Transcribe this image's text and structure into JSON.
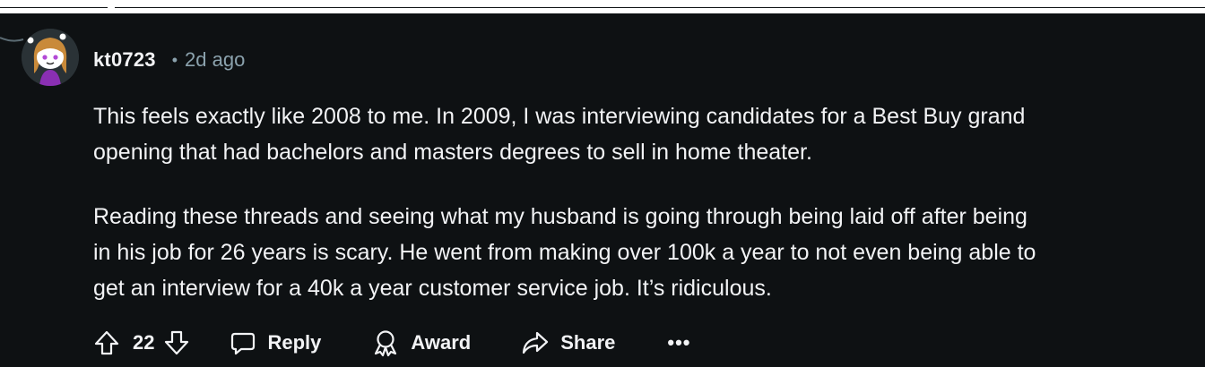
{
  "comment": {
    "username": "kt0723",
    "separator": "•",
    "time": "2d ago",
    "paragraphs": [
      "This feels exactly like 2008 to me. In 2009, I was interviewing candidates for a Best Buy grand\nopening that had bachelors and masters degrees to sell in home theater.",
      "Reading these threads and seeing what my husband is going through being laid off after being\nin his job for 26 years is scary. He went from making over 100k a year to not even being able to\nget an interview for a 40k a year customer service job. It’s ridiculous."
    ]
  },
  "actions": {
    "vote_count": "22",
    "reply_label": "Reply",
    "award_label": "Award",
    "share_label": "Share",
    "more_label": "•••"
  },
  "icons": {
    "upvote": "arrow-up-icon",
    "downvote": "arrow-down-icon",
    "reply": "speech-bubble-icon",
    "award": "award-ribbon-icon",
    "share": "share-arrow-icon",
    "more": "more-dots-icon"
  },
  "colors": {
    "background": "#0e1113",
    "text": "#f2f3f5",
    "muted": "#8ba2ad",
    "avatar_hair": "#c98a3a",
    "avatar_shirt": "#8a2fb3"
  }
}
